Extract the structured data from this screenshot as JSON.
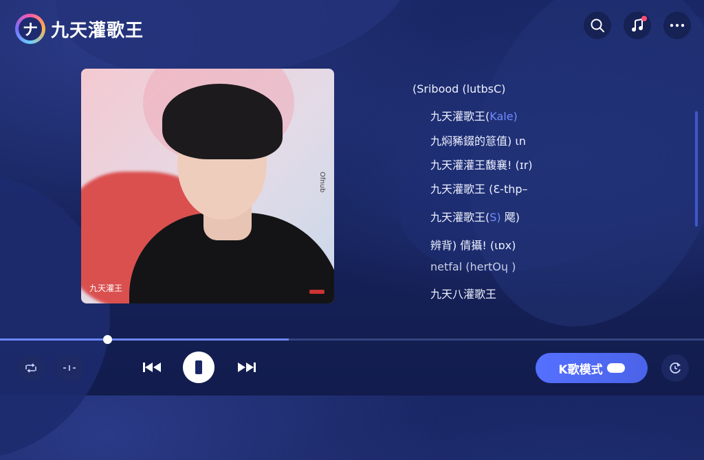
{
  "app": {
    "title": "九天灌歌王",
    "logo_glyph": "ナ"
  },
  "header": {
    "search_icon": "search-icon",
    "music_icon": "music-note-icon",
    "more_icon": "more-icon"
  },
  "album": {
    "caption": "九天灌王",
    "side_text": "Ofnub"
  },
  "lyrics": [
    {
      "text": "(Sribood (lutbsC)",
      "highlight": ""
    },
    {
      "text": "九天灌歌王(",
      "highlight": "Kale)"
    },
    {
      "text": "九焖豨錣的䈚值) ",
      "highlight": "",
      "tail": "ιn"
    },
    {
      "text": "九天灌灌王馥襄! (ɪr)",
      "highlight": ""
    },
    {
      "text": "九天灌歌王 (",
      "highlight": "",
      "tail": "Ɛ-thp–"
    },
    {
      "text": "九天灌歌王(",
      "highlight": "S)",
      "tail": " 飔)"
    },
    {
      "text": "辨背) 倩攝! (ιɒx)",
      "highlight": ""
    },
    {
      "text": "netfal (hertOɥ )",
      "highlight": ""
    },
    {
      "text": "九天八灌歌王",
      "highlight": ""
    }
  ],
  "playback": {
    "progress": 0.41,
    "position": 0.152
  },
  "controls": {
    "loop_icon": "repeat-icon",
    "audio_icon": "audio-wave-icon",
    "prev_icon": "previous-icon",
    "pause_icon": "pause-icon",
    "next_icon": "next-icon",
    "karaoke_label": "K歌模式",
    "refresh_icon": "refresh-icon"
  },
  "colors": {
    "accent": "#5570ff",
    "background": "#1a2766",
    "highlight": "#6f8cff"
  }
}
